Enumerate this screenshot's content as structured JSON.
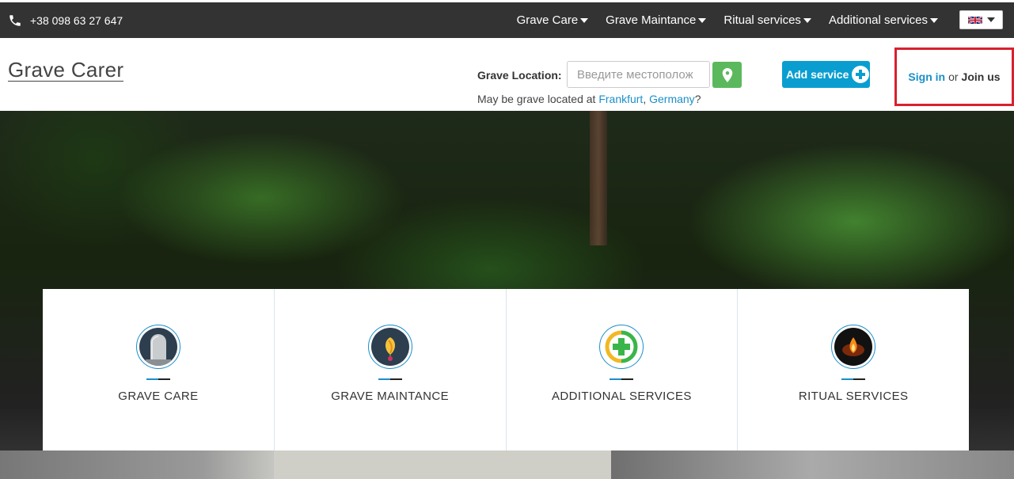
{
  "topbar": {
    "phone": "+38 098 63 27 647",
    "nav": [
      {
        "label": "Grave Care"
      },
      {
        "label": "Grave Maintance"
      },
      {
        "label": "Ritual services"
      },
      {
        "label": "Additional services"
      }
    ],
    "language_icon": "uk-flag-icon"
  },
  "header": {
    "logo": "Grave Carer",
    "location_label": "Grave Location:",
    "location_placeholder": "Введите местополож",
    "suggest_prefix": "May be grave located at ",
    "suggest_city": "Frankfurt",
    "suggest_sep": ", ",
    "suggest_country": "Germany",
    "suggest_suffix": "?",
    "add_service": "Add service",
    "sign_in": "Sign in",
    "or": "or",
    "join_us": "Join us"
  },
  "cards": [
    {
      "title": "GRAVE CARE",
      "icon": "gravestone-icon"
    },
    {
      "title": "GRAVE MAINTANCE",
      "icon": "flower-icon"
    },
    {
      "title": "ADDITIONAL SERVICES",
      "icon": "plus-circle-icon"
    },
    {
      "title": "RITUAL SERVICES",
      "icon": "candle-flame-icon"
    }
  ],
  "colors": {
    "topbar_bg": "#333333",
    "accent_blue": "#0a9ed0",
    "link_blue": "#1a8fc9",
    "location_btn_green": "#5cb85c",
    "highlight_red": "#d9202e"
  }
}
